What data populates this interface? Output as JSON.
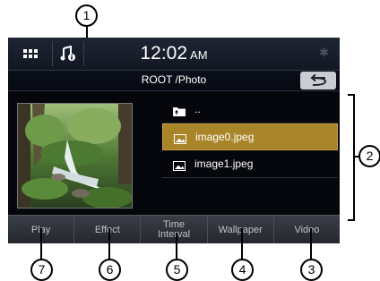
{
  "callouts": {
    "c1": "1",
    "c2": "2",
    "c3": "3",
    "c4": "4",
    "c5": "5",
    "c6": "6",
    "c7": "7"
  },
  "statusbar": {
    "time": "12:02",
    "ampm": "AM",
    "icons": [
      "grid-icon",
      "music-info-icon",
      "bluetooth-icon"
    ]
  },
  "path": "ROOT /Photo",
  "back_icon": "back-arrow-icon",
  "files": [
    {
      "name": "..",
      "icon": "folder-up-icon"
    },
    {
      "name": "image0.jpeg",
      "icon": "image-file-icon",
      "selected": true
    },
    {
      "name": "image1.jpeg",
      "icon": "image-file-icon"
    }
  ],
  "preview_icon": "waterfall-photo-thumbnail",
  "bottom": {
    "play": "Play",
    "effect": "Effect",
    "time_interval_1": "Time",
    "time_interval_2": "Interval",
    "wallpaper": "Wallpaper",
    "video": "Video"
  },
  "colors": {
    "selection": "#a9852a",
    "screen_bg": "#05070d"
  }
}
